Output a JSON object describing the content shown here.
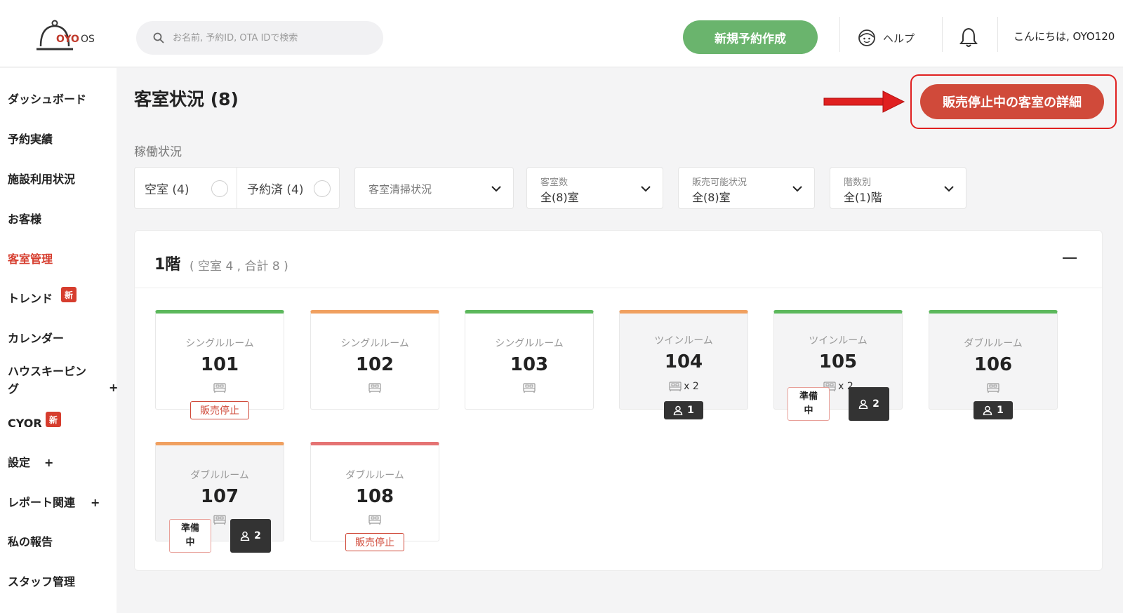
{
  "header": {
    "logo": {
      "brand": "OYO",
      "suffix": "OS"
    },
    "search": {
      "placeholder": "お名前, 予約ID, OTA IDで検索"
    },
    "new_reservation_button": "新規予約作成",
    "help_label": "ヘルプ",
    "greeting": "こんにちは, OYO120"
  },
  "sidebar": {
    "items": [
      {
        "label": "ダッシュボード"
      },
      {
        "label": "予約実績"
      },
      {
        "label": "施設利用状況"
      },
      {
        "label": "お客様"
      },
      {
        "label": "客室管理",
        "active": true
      },
      {
        "label": "トレンド",
        "badge": "新"
      },
      {
        "label": "カレンダー"
      },
      {
        "label": "ハウスキーピン\nグ",
        "expandable": "+"
      },
      {
        "label": "CYOR",
        "badge": "新"
      },
      {
        "label": "設定",
        "expandable": "+"
      },
      {
        "label": "レポート関連",
        "expandable": "+"
      },
      {
        "label": "私の報告"
      },
      {
        "label": "スタッフ管理"
      }
    ]
  },
  "main": {
    "title": "客室状況 (8)",
    "out_of_service_button": "販売停止中の客室の詳細",
    "operation_label": "稼働状況",
    "status_chips": [
      {
        "label": "空室 (4)"
      },
      {
        "label": "予約済 (4)"
      }
    ],
    "filters": {
      "cleaning": {
        "label": "客室清掃状況"
      },
      "room_count": {
        "caption": "客室数",
        "value": "全(8)室"
      },
      "sale_status": {
        "caption": "販売可能状況",
        "value": "全(8)室"
      },
      "floor": {
        "caption": "階数別",
        "value": "全(1)階"
      }
    },
    "floor": {
      "name": "1階",
      "summary": "( 空室 4 , 合計 8 )"
    },
    "rooms": [
      {
        "type": "シングルルーム",
        "number": "101",
        "bed_count": "",
        "accent": "#5cb85c",
        "occupied": false,
        "tag_oos": "販売停止",
        "tag_prep": "",
        "guests": ""
      },
      {
        "type": "シングルルーム",
        "number": "102",
        "bed_count": "",
        "accent": "#f0a060",
        "occupied": false,
        "tag_oos": "",
        "tag_prep": "",
        "guests": ""
      },
      {
        "type": "シングルルーム",
        "number": "103",
        "bed_count": "",
        "accent": "#5cb85c",
        "occupied": false,
        "tag_oos": "",
        "tag_prep": "",
        "guests": ""
      },
      {
        "type": "ツインルーム",
        "number": "104",
        "bed_count": "x 2",
        "accent": "#f0a060",
        "occupied": true,
        "tag_oos": "",
        "tag_prep": "",
        "guests": "1"
      },
      {
        "type": "ツインルーム",
        "number": "105",
        "bed_count": "x 2",
        "accent": "#5cb85c",
        "occupied": true,
        "tag_oos": "",
        "tag_prep": "準備\n中",
        "guests": "2"
      },
      {
        "type": "ダブルルーム",
        "number": "106",
        "bed_count": "",
        "accent": "#5cb85c",
        "occupied": true,
        "tag_oos": "",
        "tag_prep": "",
        "guests": "1"
      },
      {
        "type": "ダブルルーム",
        "number": "107",
        "bed_count": "",
        "accent": "#f0a060",
        "occupied": true,
        "tag_oos": "",
        "tag_prep": "準備\n中",
        "guests": "2"
      },
      {
        "type": "ダブルルーム",
        "number": "108",
        "bed_count": "",
        "accent": "#e57373",
        "occupied": false,
        "tag_oos": "販売停止",
        "tag_prep": "",
        "guests": ""
      }
    ]
  },
  "colors": {
    "brand_red": "#d04a3a",
    "primary_green": "#6ab46d",
    "available_green": "#5cb85c",
    "reserved_orange": "#f0a060",
    "blocked_red": "#e57373"
  }
}
